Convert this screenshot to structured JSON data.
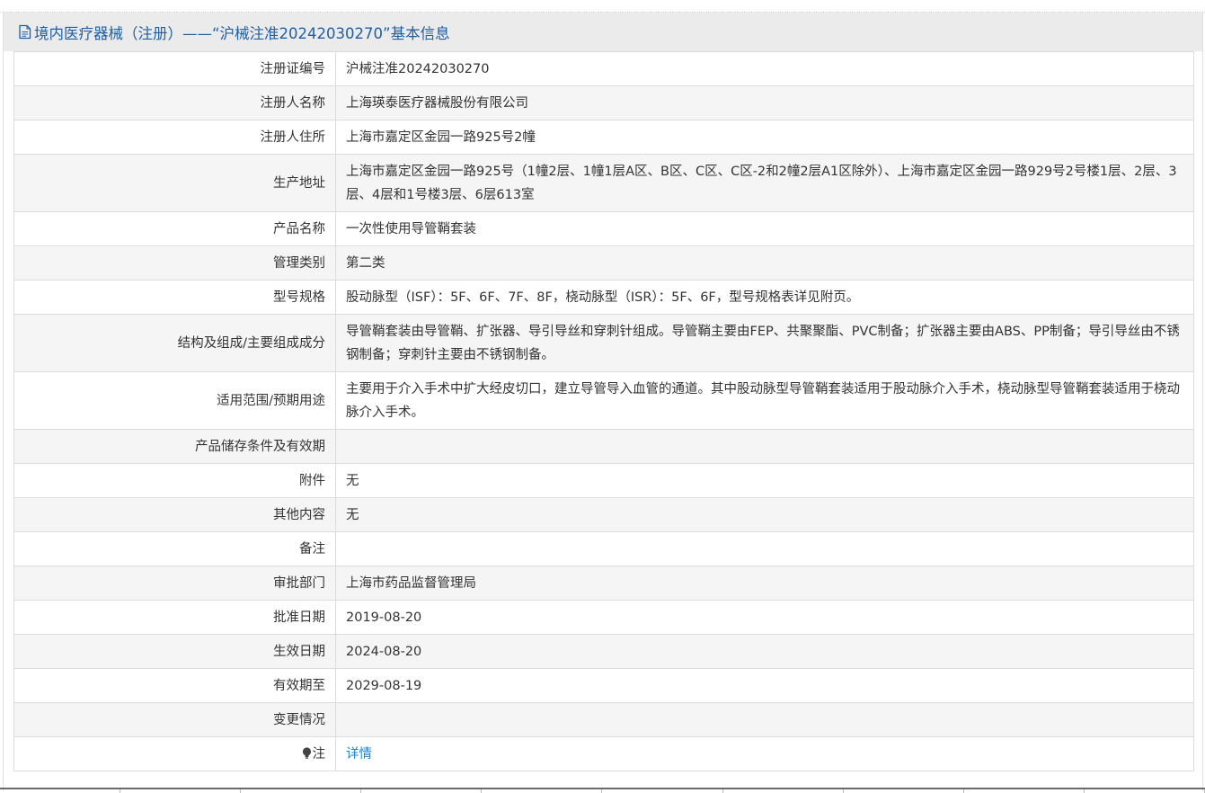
{
  "header": {
    "title": "境内医疗器械（注册）——“沪械注准20242030270”基本信息",
    "icon": "document-icon"
  },
  "rows": [
    {
      "label": "注册证编号",
      "value": "沪械注准20242030270"
    },
    {
      "label": "注册人名称",
      "value": "上海瑛泰医疗器械股份有限公司"
    },
    {
      "label": "注册人住所",
      "value": "上海市嘉定区金园一路925号2幢"
    },
    {
      "label": "生产地址",
      "value": "上海市嘉定区金园一路925号（1幢2层、1幢1层A区、B区、C区、C区-2和2幢2层A1区除外）、上海市嘉定区金园一路929号2号楼1层、2层、3层、4层和1号楼3层、6层613室"
    },
    {
      "label": "产品名称",
      "value": "一次性使用导管鞘套装"
    },
    {
      "label": "管理类别",
      "value": "第二类"
    },
    {
      "label": "型号规格",
      "value": "股动脉型（ISF）：5F、6F、7F、8F，桡动脉型（ISR）：5F、6F，型号规格表详见附页。"
    },
    {
      "label": "结构及组成/主要组成成分",
      "value": "导管鞘套装由导管鞘、扩张器、导引导丝和穿刺针组成。导管鞘主要由FEP、共聚聚酯、PVC制备；扩张器主要由ABS、PP制备；导引导丝由不锈钢制备；穿刺针主要由不锈钢制备。"
    },
    {
      "label": "适用范围/预期用途",
      "value": "主要用于介入手术中扩大经皮切口，建立导管导入血管的通道。其中股动脉型导管鞘套装适用于股动脉介入手术，桡动脉型导管鞘套装适用于桡动脉介入手术。"
    },
    {
      "label": "产品储存条件及有效期",
      "value": ""
    },
    {
      "label": "附件",
      "value": "无"
    },
    {
      "label": "其他内容",
      "value": "无"
    },
    {
      "label": "备注",
      "value": ""
    },
    {
      "label": "审批部门",
      "value": "上海市药品监督管理局"
    },
    {
      "label": "批准日期",
      "value": "2019-08-20"
    },
    {
      "label": "生效日期",
      "value": "2024-08-20"
    },
    {
      "label": "有效期至",
      "value": "2029-08-19"
    },
    {
      "label": "变更情况",
      "value": ""
    }
  ],
  "note_row": {
    "label": "注",
    "icon": "lightbulb-icon",
    "link_text": "详情"
  },
  "colors": {
    "header_text": "#1f5fa5",
    "link": "#1e82d2",
    "row_alt_bg": "#f5f5f5",
    "header_bg": "#ebebeb"
  }
}
